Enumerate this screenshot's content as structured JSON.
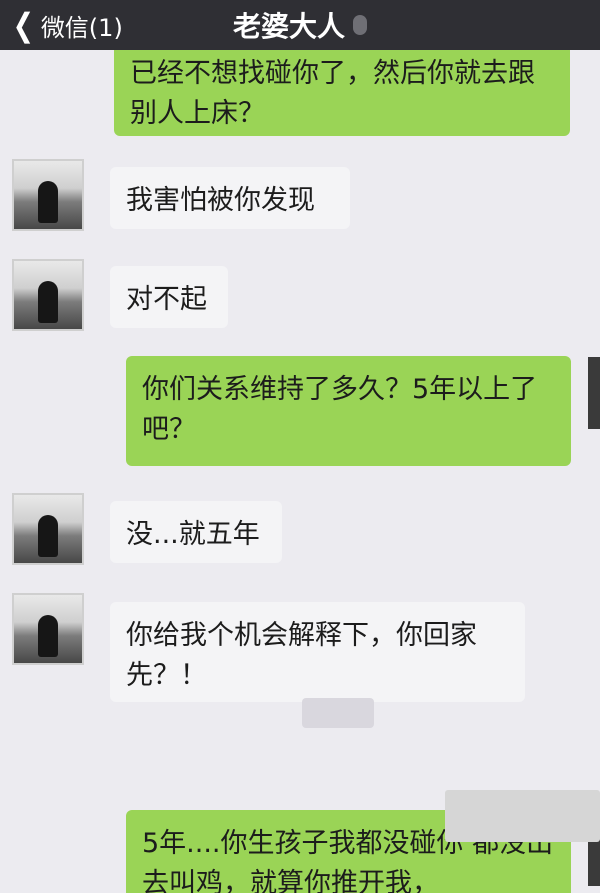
{
  "header": {
    "back_label": "微信(1)",
    "contact_name": "老婆大人",
    "mute_icon": "muted-bell-icon"
  },
  "messages": [
    {
      "side": "sent",
      "text": "已经不想找碰你了，然后你就去跟别人上床？"
    },
    {
      "side": "received",
      "text": "我害怕被你发现"
    },
    {
      "side": "received",
      "text": "对不起"
    },
    {
      "side": "sent",
      "text": "你们关系维持了多久？5年以上了吧？"
    },
    {
      "side": "received",
      "text": "没...就五年"
    },
    {
      "side": "received",
      "text": "你给我个机会解释下，你回家先？！"
    },
    {
      "side": "sent",
      "text": "5年....你生孩子我都没碰你 都没出去叫鸡，就算你推开我，"
    }
  ],
  "colors": {
    "header_bg": "#2f2f34",
    "chat_bg": "#ecebf0",
    "sent_bubble": "#9ad456",
    "received_bubble": "#f4f4f6"
  }
}
